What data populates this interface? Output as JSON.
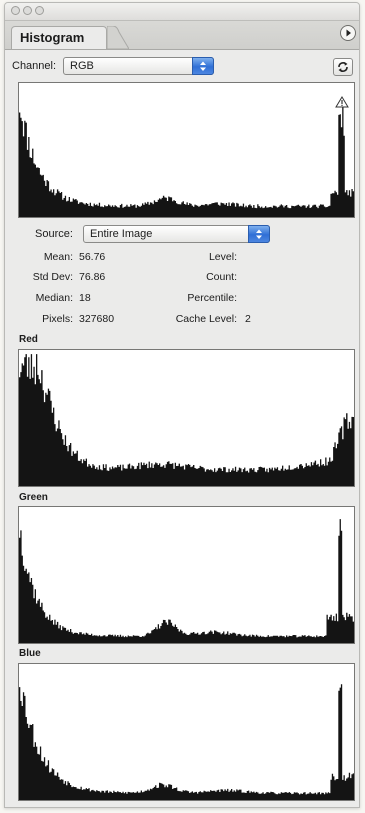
{
  "panel": {
    "tab_title": "Histogram",
    "channel_label": "Channel:",
    "channel_value": "RGB",
    "source_label": "Source:",
    "source_value": "Entire Image"
  },
  "stats": {
    "mean_label": "Mean:",
    "mean_value": "56.76",
    "stddev_label": "Std Dev:",
    "stddev_value": "76.86",
    "median_label": "Median:",
    "median_value": "18",
    "pixels_label": "Pixels:",
    "pixels_value": "327680",
    "level_label": "Level:",
    "level_value": "",
    "count_label": "Count:",
    "count_value": "",
    "percentile_label": "Percentile:",
    "percentile_value": "",
    "cache_level_label": "Cache Level:",
    "cache_level_value": "2"
  },
  "channels": {
    "red_label": "Red",
    "green_label": "Green",
    "blue_label": "Blue"
  },
  "icons": {
    "warning": "warning-triangle-icon",
    "refresh": "refresh-icon",
    "panel_menu": "panel-menu-arrow-icon",
    "dropdown": "double-chevron-icon"
  },
  "colors": {
    "accent": "#2f6fd6",
    "histogram_fill": "#141414"
  }
}
